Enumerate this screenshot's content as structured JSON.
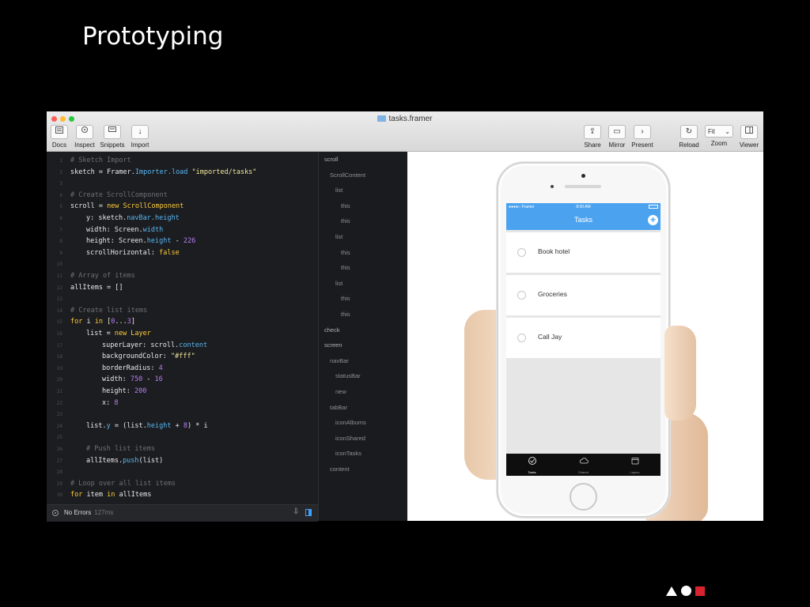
{
  "slide": {
    "title": "Prototyping"
  },
  "window": {
    "title": "tasks.framer",
    "colors": {
      "close": "#ff5f57",
      "minimize": "#febc2e",
      "zoom": "#28c840"
    }
  },
  "toolbar": {
    "left": [
      {
        "label": "Docs",
        "icon": "docs-icon"
      },
      {
        "label": "Inspect",
        "icon": "inspect-icon"
      },
      {
        "label": "Snippets",
        "icon": "snippets-icon"
      },
      {
        "label": "Import",
        "icon": "import-icon"
      }
    ],
    "right": [
      {
        "label": "Share",
        "icon": "share-icon"
      },
      {
        "label": "Mirror",
        "icon": "mirror-icon"
      },
      {
        "label": "Present",
        "icon": "present-icon"
      },
      {
        "label": "Reload",
        "icon": "reload-icon"
      },
      {
        "label": "Zoom",
        "icon": "zoom-select",
        "value": "Fit"
      },
      {
        "label": "Viewer",
        "icon": "viewer-icon"
      }
    ]
  },
  "code": {
    "lines": [
      {
        "n": "1",
        "indent": 0,
        "tokens": [
          {
            "t": "# Sketch Import",
            "c": "cm"
          }
        ]
      },
      {
        "n": "2",
        "indent": 0,
        "tokens": [
          {
            "t": "sketch = Framer.",
            "c": "id"
          },
          {
            "t": "Importer.load",
            "c": "pr"
          },
          {
            "t": " \"imported/tasks\"",
            "c": "st"
          }
        ]
      },
      {
        "n": "3",
        "indent": 0,
        "tokens": []
      },
      {
        "n": "4",
        "indent": 0,
        "tokens": [
          {
            "t": "# Create ScrollComponent",
            "c": "cm"
          }
        ]
      },
      {
        "n": "5",
        "indent": 0,
        "tokens": [
          {
            "t": "scroll = ",
            "c": "id"
          },
          {
            "t": "new ScrollComponent",
            "c": "kw"
          }
        ]
      },
      {
        "n": "6",
        "indent": 1,
        "tokens": [
          {
            "t": "y: sketch.",
            "c": "id"
          },
          {
            "t": "navBar.height",
            "c": "pr"
          }
        ]
      },
      {
        "n": "7",
        "indent": 1,
        "tokens": [
          {
            "t": "width: Screen.",
            "c": "id"
          },
          {
            "t": "width",
            "c": "pr"
          }
        ]
      },
      {
        "n": "8",
        "indent": 1,
        "tokens": [
          {
            "t": "height: Screen.",
            "c": "id"
          },
          {
            "t": "height",
            "c": "pr"
          },
          {
            "t": " - ",
            "c": "id"
          },
          {
            "t": "226",
            "c": "nu"
          }
        ]
      },
      {
        "n": "9",
        "indent": 1,
        "tokens": [
          {
            "t": "scrollHorizontal: ",
            "c": "id"
          },
          {
            "t": "false",
            "c": "kw"
          }
        ]
      },
      {
        "n": "10",
        "indent": 0,
        "tokens": []
      },
      {
        "n": "11",
        "indent": 0,
        "tokens": [
          {
            "t": "# Array of items",
            "c": "cm"
          }
        ]
      },
      {
        "n": "12",
        "indent": 0,
        "tokens": [
          {
            "t": "allItems = []",
            "c": "id"
          }
        ]
      },
      {
        "n": "13",
        "indent": 0,
        "tokens": []
      },
      {
        "n": "14",
        "indent": 0,
        "tokens": [
          {
            "t": "# Create list items",
            "c": "cm"
          }
        ]
      },
      {
        "n": "15",
        "indent": 0,
        "tokens": [
          {
            "t": "for",
            "c": "kw"
          },
          {
            "t": " i ",
            "c": "id"
          },
          {
            "t": "in",
            "c": "kw"
          },
          {
            "t": " [",
            "c": "id"
          },
          {
            "t": "0",
            "c": "nu"
          },
          {
            "t": "...",
            "c": "id"
          },
          {
            "t": "3",
            "c": "nu"
          },
          {
            "t": "]",
            "c": "id"
          }
        ]
      },
      {
        "n": "16",
        "indent": 1,
        "tokens": [
          {
            "t": "list = ",
            "c": "id"
          },
          {
            "t": "new Layer",
            "c": "kw"
          }
        ]
      },
      {
        "n": "17",
        "indent": 2,
        "tokens": [
          {
            "t": "superLayer: scroll.",
            "c": "id"
          },
          {
            "t": "content",
            "c": "pr"
          }
        ]
      },
      {
        "n": "18",
        "indent": 2,
        "tokens": [
          {
            "t": "backgroundColor: ",
            "c": "id"
          },
          {
            "t": "\"#fff\"",
            "c": "st"
          }
        ]
      },
      {
        "n": "19",
        "indent": 2,
        "tokens": [
          {
            "t": "borderRadius: ",
            "c": "id"
          },
          {
            "t": "4",
            "c": "nu"
          }
        ]
      },
      {
        "n": "20",
        "indent": 2,
        "tokens": [
          {
            "t": "width: ",
            "c": "id"
          },
          {
            "t": "750",
            "c": "nu"
          },
          {
            "t": " - ",
            "c": "id"
          },
          {
            "t": "16",
            "c": "nu"
          }
        ]
      },
      {
        "n": "21",
        "indent": 2,
        "tokens": [
          {
            "t": "height: ",
            "c": "id"
          },
          {
            "t": "200",
            "c": "nu"
          }
        ]
      },
      {
        "n": "22",
        "indent": 2,
        "tokens": [
          {
            "t": "x: ",
            "c": "id"
          },
          {
            "t": "8",
            "c": "nu"
          }
        ]
      },
      {
        "n": "23",
        "indent": 0,
        "tokens": []
      },
      {
        "n": "24",
        "indent": 1,
        "tokens": [
          {
            "t": "list.",
            "c": "id"
          },
          {
            "t": "y",
            "c": "pr"
          },
          {
            "t": " = (list.",
            "c": "id"
          },
          {
            "t": "height",
            "c": "pr"
          },
          {
            "t": " + ",
            "c": "id"
          },
          {
            "t": "8",
            "c": "nu"
          },
          {
            "t": ") * i",
            "c": "id"
          }
        ]
      },
      {
        "n": "25",
        "indent": 0,
        "tokens": []
      },
      {
        "n": "26",
        "indent": 1,
        "tokens": [
          {
            "t": "# Push list items",
            "c": "cm"
          }
        ]
      },
      {
        "n": "27",
        "indent": 1,
        "tokens": [
          {
            "t": "allItems.",
            "c": "id"
          },
          {
            "t": "push",
            "c": "pr"
          },
          {
            "t": "(list)",
            "c": "id"
          }
        ]
      },
      {
        "n": "28",
        "indent": 0,
        "tokens": []
      },
      {
        "n": "29",
        "indent": 0,
        "tokens": [
          {
            "t": "# Loop over all list items",
            "c": "cm"
          }
        ]
      },
      {
        "n": "30",
        "indent": 0,
        "tokens": [
          {
            "t": "for",
            "c": "kw"
          },
          {
            "t": " item ",
            "c": "id"
          },
          {
            "t": "in",
            "c": "kw"
          },
          {
            "t": " allItems",
            "c": "id"
          }
        ]
      }
    ]
  },
  "status": {
    "text": "No Errors",
    "time": "127ms"
  },
  "layers": [
    {
      "label": "scroll",
      "depth": 0
    },
    {
      "label": "ScrollContent",
      "depth": 1
    },
    {
      "label": "list",
      "depth": 2
    },
    {
      "label": "this",
      "depth": 3
    },
    {
      "label": "this",
      "depth": 3
    },
    {
      "label": "list",
      "depth": 2
    },
    {
      "label": "this",
      "depth": 3
    },
    {
      "label": "this",
      "depth": 3
    },
    {
      "label": "list",
      "depth": 2
    },
    {
      "label": "this",
      "depth": 3
    },
    {
      "label": "this",
      "depth": 3
    },
    {
      "label": "check",
      "depth": 0
    },
    {
      "label": "screen",
      "depth": 0
    },
    {
      "label": "navBar",
      "depth": 1
    },
    {
      "label": "statusBar",
      "depth": 2
    },
    {
      "label": "new",
      "depth": 2
    },
    {
      "label": "tabBar",
      "depth": 1
    },
    {
      "label": "iconAlbums",
      "depth": 2
    },
    {
      "label": "iconShared",
      "depth": 2
    },
    {
      "label": "iconTasks",
      "depth": 2
    },
    {
      "label": "content",
      "depth": 1
    }
  ],
  "phone": {
    "status_left": "●●●●○ Framer",
    "status_center": "8:00 AM",
    "nav_title": "Tasks",
    "add_symbol": "+",
    "tasks": [
      "Book hotel",
      "Groceries",
      "Call Jay"
    ],
    "tabs": [
      {
        "label": "Tasks",
        "icon": "check-circle-icon"
      },
      {
        "label": "Shared",
        "icon": "cloud-icon"
      },
      {
        "label": "Layers",
        "icon": "layers-icon"
      }
    ],
    "accent": "#4ba3f0"
  },
  "logo": {
    "colors": {
      "triangle": "#ffffff",
      "circle": "#ffffff",
      "square": "#d9232f"
    }
  }
}
